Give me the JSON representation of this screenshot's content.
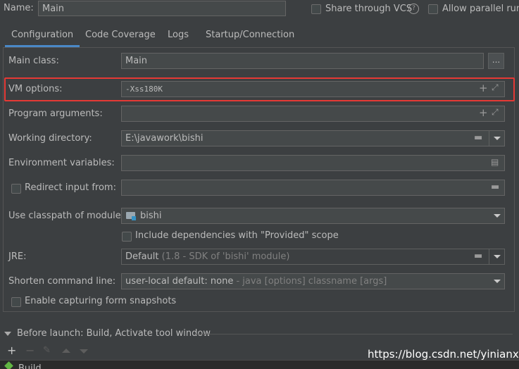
{
  "header": {
    "name_label": "Name:",
    "name_value": "Main",
    "share_vcs_label": "Share through VCS",
    "help_icon": "question-circle-icon",
    "allow_parallel_label": "Allow parallel run"
  },
  "tabs": [
    {
      "label": "Configuration",
      "active": true
    },
    {
      "label": "Code Coverage"
    },
    {
      "label": "Logs"
    },
    {
      "label": "Startup/Connection"
    }
  ],
  "form": {
    "main_class": {
      "label": "Main class:",
      "value": "Main",
      "button": "..."
    },
    "vm_options": {
      "label": "VM options:",
      "value": "-Xss180K"
    },
    "program_arguments": {
      "label": "Program arguments:",
      "value": ""
    },
    "working_directory": {
      "label": "Working directory:",
      "value": "E:\\javawork\\bishi"
    },
    "environment_variables": {
      "label": "Environment variables:",
      "value": ""
    },
    "redirect_input": {
      "label": "Redirect input from:",
      "value": ""
    },
    "classpath_module": {
      "label": "Use classpath of module:",
      "value": "bishi"
    },
    "include_deps": {
      "label": "Include dependencies with \"Provided\" scope"
    },
    "jre": {
      "label": "JRE:",
      "value_main": "Default",
      "value_hint": "(1.8 - SDK of 'bishi' module)"
    },
    "shorten": {
      "label": "Shorten command line:",
      "value_main": "user-local default: none",
      "value_hint": " - java [options] classname [args]"
    },
    "enable_snapshots": {
      "label": "Enable capturing form snapshots"
    }
  },
  "before_launch": {
    "label": "Before launch: Build, Activate tool window",
    "item": "Build"
  },
  "watermark": "https://blog.csdn.net/yinianxx",
  "colors": {
    "highlight": "#e53935",
    "accent": "#4a88c7"
  }
}
